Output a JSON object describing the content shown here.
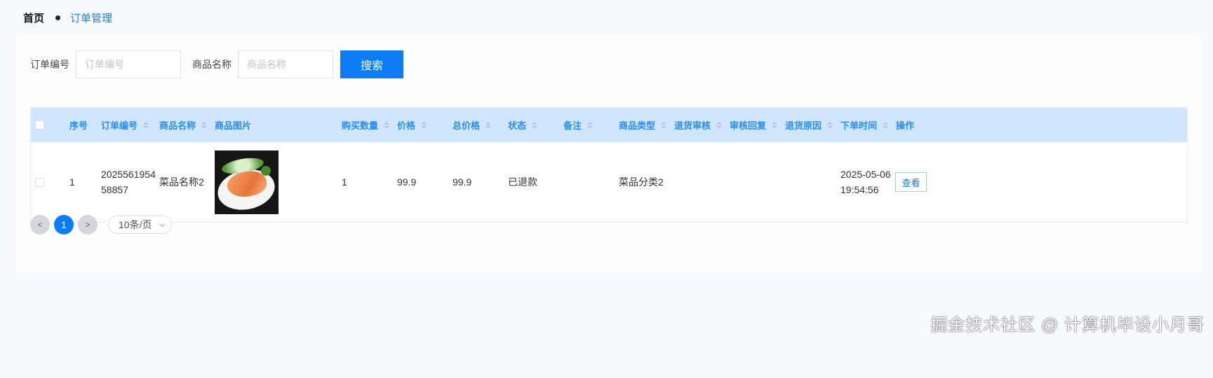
{
  "breadcrumb": {
    "home": "首页",
    "current": "订单管理"
  },
  "search": {
    "order_no_label": "订单编号",
    "order_no_placeholder": "订单编号",
    "product_name_label": "商品名称",
    "product_name_placeholder": "商品名称",
    "button_label": "搜索"
  },
  "table": {
    "headers": {
      "index": "序号",
      "order_no": "订单编号",
      "product_name": "商品名称",
      "product_image": "商品图片",
      "quantity": "购买数量",
      "price": "价格",
      "total": "总价格",
      "status": "状态",
      "remark": "备注",
      "product_type": "商品类型",
      "return_review": "退货审核",
      "review_reply": "审核回复",
      "return_reason": "退货原因",
      "order_time": "下单时间",
      "actions": "操作"
    },
    "rows": [
      {
        "index": "1",
        "order_no_line1": "2025561954",
        "order_no_line2": "58857",
        "product_name": "菜品名称2",
        "quantity": "1",
        "price": "99.9",
        "total": "99.9",
        "status": "已退款",
        "remark": "",
        "product_type": "菜品分类2",
        "return_review": "",
        "review_reply": "",
        "return_reason": "",
        "order_date": "2025-05-06",
        "order_clock": "19:54:56",
        "view_label": "查看"
      }
    ]
  },
  "pagination": {
    "prev": "<",
    "current_page": "1",
    "next": ">",
    "page_size": "10条/页"
  },
  "watermark": "掘金技术社区 @ 计算机毕设小月哥",
  "colors": {
    "accent": "#0d7cf2",
    "header_bg": "#cfe6fc",
    "header_text": "#2a8cf0",
    "page_bg": "#f6f9fe"
  }
}
